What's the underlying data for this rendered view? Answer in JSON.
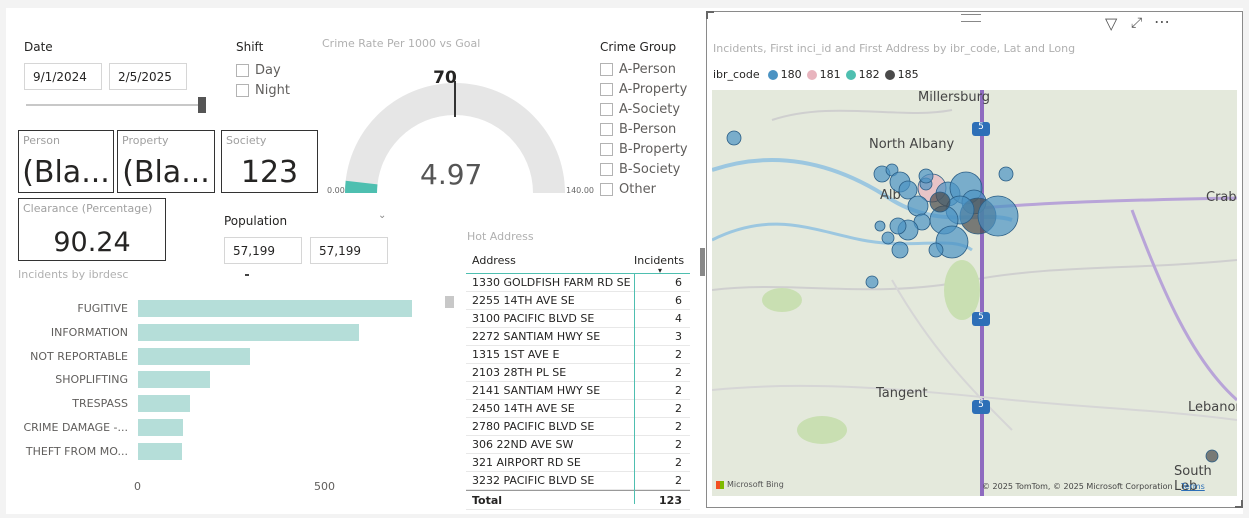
{
  "date": {
    "label": "Date",
    "start": "9/1/2024",
    "end": "2/5/2025"
  },
  "shift": {
    "label": "Shift",
    "options": [
      "Day",
      "Night"
    ]
  },
  "cards": {
    "person": {
      "title": "Person",
      "value": "(Bla..."
    },
    "property": {
      "title": "Property",
      "value": "(Bla..."
    },
    "society": {
      "title": "Society",
      "value": "123"
    },
    "clearance": {
      "title": "Clearance (Percentage)",
      "value": "90.24"
    }
  },
  "gauge": {
    "title": "Crime Rate Per 1000 vs Goal",
    "target_label": "70",
    "value_label": "4.97",
    "min_label": "0.00",
    "max_label": "140.00",
    "value": 4.97,
    "target": 70,
    "min": 0,
    "max": 140,
    "fill_color": "#4ebfb0"
  },
  "population": {
    "label": "Population",
    "min": "57,199",
    "max": "57,199"
  },
  "crime_group": {
    "label": "Crime Group",
    "options": [
      "A-Person",
      "A-Property",
      "A-Society",
      "B-Person",
      "B-Property",
      "B-Society",
      "Other"
    ]
  },
  "chart_data": {
    "type": "bar",
    "title": "Incidents by ibrdesc",
    "categories": [
      "FUGITIVE",
      "INFORMATION",
      "NOT REPORTABLE",
      "SHOPLIFTING",
      "TRESPASS",
      "CRIME DAMAGE -...",
      "THEFT FROM MO..."
    ],
    "values": [
      760,
      615,
      310,
      200,
      145,
      125,
      122
    ],
    "xticks": [
      "0",
      "500"
    ],
    "xlim": [
      0,
      1000
    ],
    "color": "#b5ded9",
    "orientation": "horizontal"
  },
  "hot_address": {
    "title": "Hot Address",
    "headers": [
      "Address",
      "Incidents"
    ],
    "rows": [
      [
        "1330 GOLDFISH FARM RD SE",
        "6"
      ],
      [
        "2255 14TH AVE SE",
        "6"
      ],
      [
        "3100 PACIFIC BLVD SE",
        "4"
      ],
      [
        "2272 SANTIAM HWY SE",
        "3"
      ],
      [
        "1315 1ST AVE E",
        "2"
      ],
      [
        "2103 28TH PL SE",
        "2"
      ],
      [
        "2141 SANTIAM HWY SE",
        "2"
      ],
      [
        "2450 14TH AVE SE",
        "2"
      ],
      [
        "2780 PACIFIC BLVD SE",
        "2"
      ],
      [
        "306 22ND AVE SW",
        "2"
      ],
      [
        "321 AIRPORT RD SE",
        "2"
      ],
      [
        "3232 PACIFIC BLVD SE",
        "2"
      ]
    ],
    "total_label": "Total",
    "total_value": "123"
  },
  "map": {
    "title": "Incidents, First inci_id and First Address by ibr_code, Lat and Long",
    "legend_title": "ibr_code",
    "legend": [
      {
        "name": "180",
        "color": "#4b93c3"
      },
      {
        "name": "181",
        "color": "#e8b4be"
      },
      {
        "name": "182",
        "color": "#4ebfb0"
      },
      {
        "name": "185",
        "color": "#4a4a4a"
      }
    ],
    "places": {
      "millersburg": "Millersburg",
      "north_albany": "North Albany",
      "albany": "Alb",
      "crabtree": "Crabt",
      "tangent": "Tangent",
      "lebanon": "Lebanoı",
      "south_lebanon": "South Leb"
    },
    "highway_shield": "5",
    "bing_label": "Microsoft Bing",
    "copyright": "© 2025 TomTom, © 2025 Microsoft Corporation",
    "terms": "Terms"
  }
}
